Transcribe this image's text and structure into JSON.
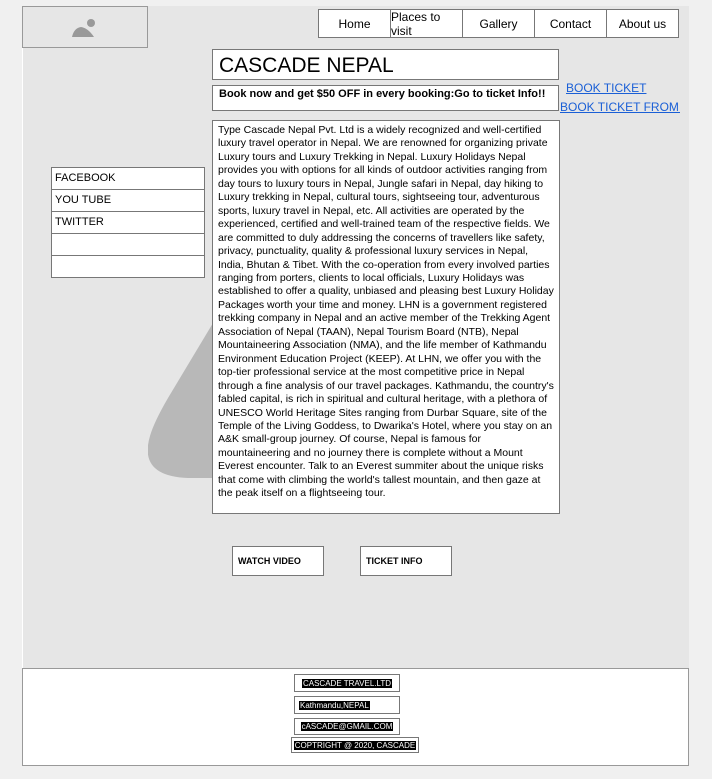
{
  "logo": {
    "icon": "image-placeholder-icon"
  },
  "nav": [
    "Home",
    "Places to visit",
    "Gallery",
    "Contact",
    "About us"
  ],
  "header": {
    "title": "CASCADE NEPAL",
    "promo": "Book now and get $50 OFF in every booking:Go to ticket Info!!"
  },
  "links": {
    "book_ticket": "BOOK TICKET",
    "book_ticket_from": "BOOK TICKET FROM TR"
  },
  "content": {
    "body": "Type Cascade Nepal Pvt. Ltd is a widely recognized and well-certified luxury travel operator in Nepal. We are renowned for organizing private Luxury tours and Luxury Trekking in Nepal. Luxury Holidays Nepal provides you with options for all kinds of outdoor activities ranging from day tours to luxury tours in Nepal, Jungle safari in Nepal, day hiking to Luxury trekking in Nepal, cultural tours, sightseeing tour, adventurous sports, luxury travel in Nepal, etc. All activities are operated by the experienced, certified and well-trained team of the respective fields. We are committed to duly addressing the concerns of travellers like safety, privacy, punctuality, quality & professional luxury services in Nepal, India, Bhutan & Tibet. With the co-operation from every involved parties ranging from porters, clients to local officials, Luxury Holidays was established to offer a quality, unbiased and pleasing best Luxury Holiday Packages worth your time and money. LHN is a government registered trekking company in Nepal and an active member of the Trekking Agent Association of Nepal (TAAN), Nepal Tourism Board (NTB), Nepal Mountaineering Association (NMA), and the life member of Kathmandu Environment Education Project (KEEP). At LHN, we offer you with the top-tier professional service at the most competitive price in Nepal through a fine analysis of our travel packages. Kathmandu, the country's fabled capital, is rich in spiritual and cultural heritage, with a plethora of UNESCO World Heritage Sites ranging from Durbar Square, site of the Temple of the Living Goddess, to Dwarika's Hotel, where you stay on an A&K small-group journey. Of course, Nepal is famous for mountaineering and no journey there is complete without a Mount Everest encounter. Talk to an Everest summiter about the unique risks that come with climbing the world's tallest mountain, and then gaze at the peak itself on a flightseeing tour."
  },
  "social": [
    "FACEBOOK",
    "YOU TUBE",
    "TWITTER",
    "",
    ""
  ],
  "buttons": {
    "watch_video": "WATCH VIDEO",
    "ticket_info": "TICKET INFO"
  },
  "footer": {
    "company": "CASCADE TRAVEL.LTD",
    "location": "Kathmandu,NEPAL",
    "email": "cASCADE@GMAIL.COM",
    "copyright": "COPTRIGHT @ 2020, CASCADE"
  }
}
